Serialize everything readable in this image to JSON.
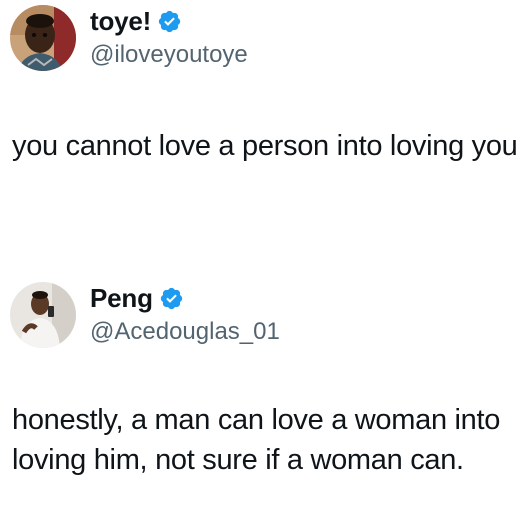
{
  "tweets": [
    {
      "display_name": "toye!",
      "verified": true,
      "handle": "@iloveyoutoye",
      "text": "you cannot love a person into loving you"
    },
    {
      "display_name": "Peng",
      "verified": true,
      "handle": "@Acedouglas_01",
      "text": "honestly, a man can love a woman into loving him, not sure if a woman can."
    }
  ],
  "colors": {
    "verified_blue": "#1d9bf0",
    "handle_gray": "#536471",
    "text": "#0f1419"
  }
}
